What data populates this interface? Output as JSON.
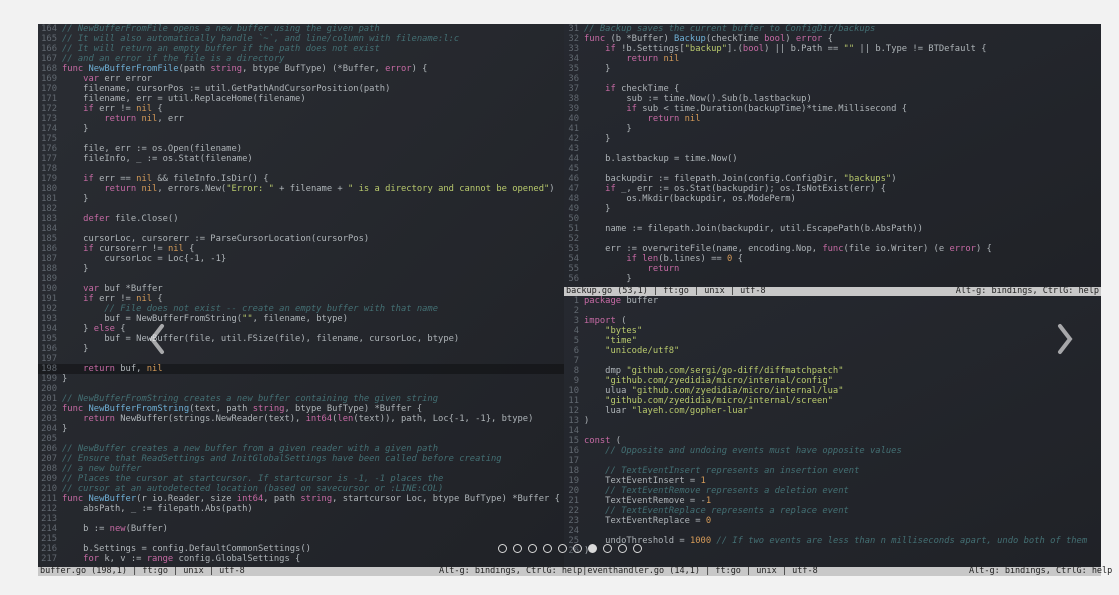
{
  "status_mid": {
    "file": "backup.go",
    "pos": "(53,1)",
    "lang": "ft:go",
    "le": "unix",
    "enc": "utf-8",
    "help": "Alt-g: bindings, CtrlG: help"
  },
  "status_bottom": {
    "left": "buffer.go (198,1) | ft:go | unix | utf-8",
    "mid": "Alt-g: bindings, CtrlG: help|eventhandler.go (14,1) | ft:go | unix | utf-8",
    "right": "Alt-g: bindings, CtrlG: help"
  },
  "carousel": {
    "total": 10,
    "active": 7
  },
  "gutters": {
    "left_start": 164,
    "left_count": 54,
    "tr_start": 31,
    "tr_count": 26,
    "br_start": 1,
    "br_count": 26
  },
  "pane_left": [
    {
      "t": "// NewBufferFromFile opens a new buffer using the given path",
      "c": "cm"
    },
    {
      "t": "// It will also automatically handle `~`, and line/column with filename:l:c",
      "c": "cm"
    },
    {
      "t": "// It will return an empty buffer if the path does not exist",
      "c": "cm"
    },
    {
      "t": "// and an error if the file is a directory",
      "c": "cm"
    },
    {
      "seg": [
        {
          "t": "func ",
          "c": "kw"
        },
        {
          "t": "NewBufferFromFile",
          "c": "fn"
        },
        {
          "t": "(path "
        },
        {
          "t": "string",
          "c": "kw"
        },
        {
          "t": ", btype BufType) (*Buffer, "
        },
        {
          "t": "error",
          "c": "kw"
        },
        {
          "t": ") {"
        }
      ]
    },
    {
      "seg": [
        {
          "t": "    var ",
          "c": "kw"
        },
        {
          "t": "err error"
        }
      ]
    },
    {
      "seg": [
        {
          "t": "    filename, cursorPos := util.GetPathAndCursorPosition(path)"
        }
      ]
    },
    {
      "seg": [
        {
          "t": "    filename, err = util.ReplaceHome(filename)"
        }
      ]
    },
    {
      "seg": [
        {
          "t": "    if ",
          "c": "kw"
        },
        {
          "t": "err != "
        },
        {
          "t": "nil ",
          "c": "num"
        },
        {
          "t": "{"
        }
      ]
    },
    {
      "seg": [
        {
          "t": "        return ",
          "c": "ret"
        },
        {
          "t": "nil",
          "c": "num"
        },
        {
          "t": ", err"
        }
      ]
    },
    {
      "t": "    }"
    },
    {
      "t": ""
    },
    {
      "seg": [
        {
          "t": "    file, err := os.Open(filename)"
        }
      ]
    },
    {
      "seg": [
        {
          "t": "    fileInfo, _ := os.Stat(filename)"
        }
      ]
    },
    {
      "t": ""
    },
    {
      "seg": [
        {
          "t": "    if ",
          "c": "kw"
        },
        {
          "t": "err == "
        },
        {
          "t": "nil ",
          "c": "num"
        },
        {
          "t": "&& fileInfo.IsDir() {"
        }
      ]
    },
    {
      "seg": [
        {
          "t": "        return ",
          "c": "ret"
        },
        {
          "t": "nil",
          "c": "num"
        },
        {
          "t": ", errors.New("
        },
        {
          "t": "\"Error: \"",
          "c": "str"
        },
        {
          "t": " + filename + "
        },
        {
          "t": "\" is a directory and cannot be opened\"",
          "c": "str"
        },
        {
          "t": ")"
        }
      ]
    },
    {
      "t": "    }"
    },
    {
      "t": ""
    },
    {
      "seg": [
        {
          "t": "    defer ",
          "c": "kw"
        },
        {
          "t": "file.Close()"
        }
      ]
    },
    {
      "t": ""
    },
    {
      "seg": [
        {
          "t": "    cursorLoc, cursorerr := ParseCursorLocation(cursorPos)"
        }
      ]
    },
    {
      "seg": [
        {
          "t": "    if ",
          "c": "kw"
        },
        {
          "t": "cursorerr != "
        },
        {
          "t": "nil ",
          "c": "num"
        },
        {
          "t": "{"
        }
      ]
    },
    {
      "seg": [
        {
          "t": "        cursorLoc = Loc{-1, -1}"
        }
      ]
    },
    {
      "t": "    }"
    },
    {
      "t": ""
    },
    {
      "seg": [
        {
          "t": "    var ",
          "c": "kw"
        },
        {
          "t": "buf *Buffer"
        }
      ]
    },
    {
      "seg": [
        {
          "t": "    if ",
          "c": "kw"
        },
        {
          "t": "err != "
        },
        {
          "t": "nil ",
          "c": "num"
        },
        {
          "t": "{"
        }
      ]
    },
    {
      "seg": [
        {
          "t": "        // File does not exist -- create an empty buffer with that name",
          "c": "cm"
        }
      ]
    },
    {
      "seg": [
        {
          "t": "        buf = NewBufferFromString("
        },
        {
          "t": "\"\"",
          "c": "str"
        },
        {
          "t": ", filename, btype)"
        }
      ]
    },
    {
      "seg": [
        {
          "t": "    } "
        },
        {
          "t": "else ",
          "c": "kw"
        },
        {
          "t": "{"
        }
      ]
    },
    {
      "seg": [
        {
          "t": "        buf = NewBuffer(file, util.FSize(file), filename, cursorLoc, btype)"
        }
      ]
    },
    {
      "t": "    }"
    },
    {
      "t": ""
    },
    {
      "seg": [
        {
          "t": "    return ",
          "c": "ret"
        },
        {
          "t": "buf, "
        },
        {
          "t": "nil",
          "c": "num"
        }
      ]
    },
    {
      "t": "}"
    },
    {
      "t": ""
    },
    {
      "t": "// NewBufferFromString creates a new buffer containing the given string",
      "c": "cm"
    },
    {
      "seg": [
        {
          "t": "func ",
          "c": "kw"
        },
        {
          "t": "NewBufferFromString",
          "c": "fn"
        },
        {
          "t": "(text, path "
        },
        {
          "t": "string",
          "c": "kw"
        },
        {
          "t": ", btype BufType) *Buffer {"
        }
      ]
    },
    {
      "seg": [
        {
          "t": "    return ",
          "c": "ret"
        },
        {
          "t": "NewBuffer(strings.NewReader(text), "
        },
        {
          "t": "int64",
          "c": "kw"
        },
        {
          "t": "("
        },
        {
          "t": "len",
          "c": "kw"
        },
        {
          "t": "(text)), path, Loc{-1, -1}, btype)"
        }
      ]
    },
    {
      "t": "}"
    },
    {
      "t": ""
    },
    {
      "t": "// NewBuffer creates a new buffer from a given reader with a given path",
      "c": "cm"
    },
    {
      "t": "// Ensure that ReadSettings and InitGlobalSettings have been called before creating",
      "c": "cm"
    },
    {
      "t": "// a new buffer",
      "c": "cm"
    },
    {
      "t": "// Places the cursor at startcursor. If startcursor is -1, -1 places the",
      "c": "cm"
    },
    {
      "t": "// cursor at an autodetected location (based on savecursor or :LINE:COL)",
      "c": "cm"
    },
    {
      "seg": [
        {
          "t": "func ",
          "c": "kw"
        },
        {
          "t": "NewBuffer",
          "c": "fn"
        },
        {
          "t": "(r io.Reader, size "
        },
        {
          "t": "int64",
          "c": "kw"
        },
        {
          "t": ", path "
        },
        {
          "t": "string",
          "c": "kw"
        },
        {
          "t": ", startcursor Loc, btype BufType) *Buffer {"
        }
      ]
    },
    {
      "seg": [
        {
          "t": "    absPath, _ := filepath.Abs(path)"
        }
      ]
    },
    {
      "t": ""
    },
    {
      "seg": [
        {
          "t": "    b := "
        },
        {
          "t": "new",
          "c": "kw"
        },
        {
          "t": "(Buffer)"
        }
      ]
    },
    {
      "t": ""
    },
    {
      "seg": [
        {
          "t": "    b.Settings = config.DefaultCommonSettings()"
        }
      ]
    },
    {
      "seg": [
        {
          "t": "    for ",
          "c": "kw"
        },
        {
          "t": "k, v := "
        },
        {
          "t": "range ",
          "c": "kw"
        },
        {
          "t": "config.GlobalSettings {"
        }
      ]
    }
  ],
  "pane_tr": [
    {
      "t": "// Backup saves the current buffer to ConfigDir/backups",
      "c": "cm"
    },
    {
      "seg": [
        {
          "t": "func ",
          "c": "kw"
        },
        {
          "t": "(b *Buffer) "
        },
        {
          "t": "Backup",
          "c": "fn"
        },
        {
          "t": "(checkTime "
        },
        {
          "t": "bool",
          "c": "kw"
        },
        {
          "t": ") "
        },
        {
          "t": "error",
          "c": "kw"
        },
        {
          "t": " {"
        }
      ]
    },
    {
      "seg": [
        {
          "t": "    if ",
          "c": "kw"
        },
        {
          "t": "!b.Settings["
        },
        {
          "t": "\"backup\"",
          "c": "str"
        },
        {
          "t": "].("
        },
        {
          "t": "bool",
          "c": "kw"
        },
        {
          "t": ") || b.Path == "
        },
        {
          "t": "\"\"",
          "c": "str"
        },
        {
          "t": " || b.Type != BTDefault {"
        }
      ]
    },
    {
      "seg": [
        {
          "t": "        return ",
          "c": "ret"
        },
        {
          "t": "nil",
          "c": "num"
        }
      ]
    },
    {
      "t": "    }"
    },
    {
      "t": ""
    },
    {
      "seg": [
        {
          "t": "    if ",
          "c": "kw"
        },
        {
          "t": "checkTime {"
        }
      ]
    },
    {
      "seg": [
        {
          "t": "        sub := time.Now().Sub(b.lastbackup)"
        }
      ]
    },
    {
      "seg": [
        {
          "t": "        if ",
          "c": "kw"
        },
        {
          "t": "sub < time.Duration(backupTime)*time.Millisecond {"
        }
      ]
    },
    {
      "seg": [
        {
          "t": "            return ",
          "c": "ret"
        },
        {
          "t": "nil",
          "c": "num"
        }
      ]
    },
    {
      "t": "        }"
    },
    {
      "t": "    }"
    },
    {
      "t": ""
    },
    {
      "seg": [
        {
          "t": "    b.lastbackup = time.Now()"
        }
      ]
    },
    {
      "t": ""
    },
    {
      "seg": [
        {
          "t": "    backupdir := filepath.Join(config.ConfigDir, "
        },
        {
          "t": "\"backups\"",
          "c": "str"
        },
        {
          "t": ")"
        }
      ]
    },
    {
      "seg": [
        {
          "t": "    if ",
          "c": "kw"
        },
        {
          "t": "_, err := os.Stat(backupdir); os.IsNotExist(err) {"
        }
      ]
    },
    {
      "seg": [
        {
          "t": "        os.Mkdir(backupdir, os.ModePerm)"
        }
      ]
    },
    {
      "t": "    }"
    },
    {
      "t": ""
    },
    {
      "seg": [
        {
          "t": "    name := filepath.Join(backupdir, util.EscapePath(b.AbsPath))"
        }
      ]
    },
    {
      "t": ""
    },
    {
      "seg": [
        {
          "t": "    err := overwriteFile(name, encoding.Nop, "
        },
        {
          "t": "func",
          "c": "kw"
        },
        {
          "t": "(file io.Writer) (e "
        },
        {
          "t": "error",
          "c": "kw"
        },
        {
          "t": ") {"
        }
      ]
    },
    {
      "seg": [
        {
          "t": "        if ",
          "c": "kw"
        },
        {
          "t": "len",
          "c": "kw"
        },
        {
          "t": "(b.lines) == "
        },
        {
          "t": "0 ",
          "c": "num"
        },
        {
          "t": "{"
        }
      ]
    },
    {
      "seg": [
        {
          "t": "            return",
          "c": "ret"
        }
      ]
    },
    {
      "t": "        }"
    }
  ],
  "pane_br": [
    {
      "seg": [
        {
          "t": "package ",
          "c": "kw"
        },
        {
          "t": "buffer"
        }
      ]
    },
    {
      "t": ""
    },
    {
      "seg": [
        {
          "t": "import ",
          "c": "kw"
        },
        {
          "t": "("
        }
      ]
    },
    {
      "seg": [
        {
          "t": "    \"bytes\"",
          "c": "str"
        }
      ]
    },
    {
      "seg": [
        {
          "t": "    \"time\"",
          "c": "str"
        }
      ]
    },
    {
      "seg": [
        {
          "t": "    \"unicode/utf8\"",
          "c": "str"
        }
      ]
    },
    {
      "t": ""
    },
    {
      "seg": [
        {
          "t": "    dmp "
        },
        {
          "t": "\"github.com/sergi/go-diff/diffmatchpatch\"",
          "c": "str"
        }
      ]
    },
    {
      "seg": [
        {
          "t": "    \"github.com/zyedidia/micro/internal/config\"",
          "c": "str"
        }
      ]
    },
    {
      "seg": [
        {
          "t": "    ulua "
        },
        {
          "t": "\"github.com/zyedidia/micro/internal/lua\"",
          "c": "str"
        }
      ]
    },
    {
      "seg": [
        {
          "t": "    \"github.com/zyedidia/micro/internal/screen\"",
          "c": "str"
        }
      ]
    },
    {
      "seg": [
        {
          "t": "    luar "
        },
        {
          "t": "\"layeh.com/gopher-luar\"",
          "c": "str"
        }
      ]
    },
    {
      "t": ")"
    },
    {
      "t": ""
    },
    {
      "seg": [
        {
          "t": "const ",
          "c": "kw"
        },
        {
          "t": "("
        }
      ]
    },
    {
      "seg": [
        {
          "t": "    // Opposite and undoing events must have opposite values",
          "c": "cm"
        }
      ]
    },
    {
      "t": ""
    },
    {
      "seg": [
        {
          "t": "    // TextEventInsert represents an insertion event",
          "c": "cm"
        }
      ]
    },
    {
      "seg": [
        {
          "t": "    TextEventInsert = "
        },
        {
          "t": "1",
          "c": "num"
        }
      ]
    },
    {
      "seg": [
        {
          "t": "    // TextEventRemove represents a deletion event",
          "c": "cm"
        }
      ]
    },
    {
      "seg": [
        {
          "t": "    TextEventRemove = -"
        },
        {
          "t": "1",
          "c": "num"
        }
      ]
    },
    {
      "seg": [
        {
          "t": "    // TextEventReplace represents a replace event",
          "c": "cm"
        }
      ]
    },
    {
      "seg": [
        {
          "t": "    TextEventReplace = "
        },
        {
          "t": "0",
          "c": "num"
        }
      ]
    },
    {
      "t": ""
    },
    {
      "seg": [
        {
          "t": "    undoThreshold = "
        },
        {
          "t": "1000",
          "c": "num"
        },
        {
          "t": " "
        },
        {
          "t": "// If two events are less than n milliseconds apart, undo both of them",
          "c": "cm"
        }
      ]
    },
    {
      "t": ")"
    }
  ]
}
